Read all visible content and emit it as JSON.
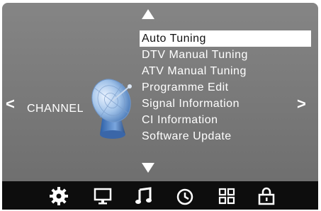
{
  "menu": {
    "category": "CHANNEL",
    "items": [
      {
        "label": "Auto Tuning",
        "selected": true
      },
      {
        "label": "DTV Manual Tuning",
        "selected": false
      },
      {
        "label": "ATV Manual Tuning",
        "selected": false
      },
      {
        "label": "Programme Edit",
        "selected": false
      },
      {
        "label": "Signal Information",
        "selected": false
      },
      {
        "label": "CI Information",
        "selected": false
      },
      {
        "label": "Software Update",
        "selected": false
      }
    ]
  },
  "nav": {
    "left": "<",
    "right": ">"
  },
  "toolbar": {
    "icons": [
      "gear-icon",
      "monitor-icon",
      "music-note-icon",
      "clock-icon",
      "grid-icon",
      "lock-icon"
    ],
    "active": "gear-icon"
  },
  "colors": {
    "panel": "#7d7d7d",
    "bar": "#0d0d0d",
    "selection": "#ffffff",
    "text": "#ffffff"
  }
}
